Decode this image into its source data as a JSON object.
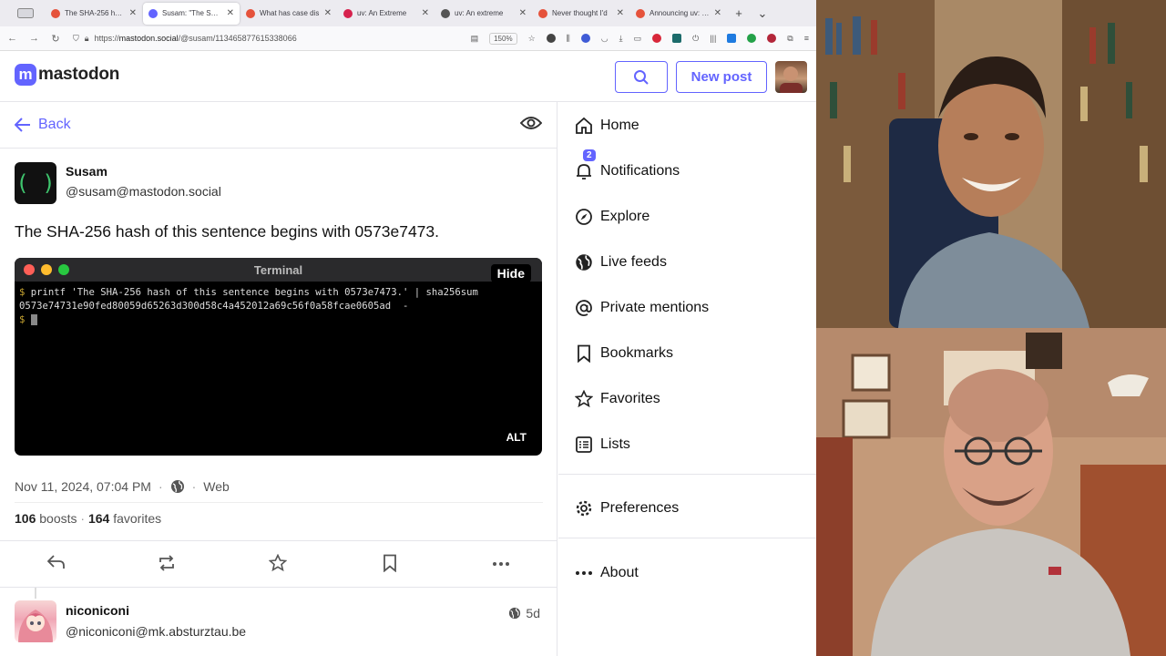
{
  "browser": {
    "tabs": [
      {
        "title": "The SHA-256 hash",
        "color": "#e5523b",
        "active": false
      },
      {
        "title": "Susam: \"The SHA-",
        "color": "#6364ff",
        "active": true
      },
      {
        "title": "What has case dis",
        "color": "#e5523b",
        "active": false
      },
      {
        "title": "uv: An Extreme",
        "color": "#d6224d",
        "active": false
      },
      {
        "title": "uv: An extreme",
        "color": "#555555",
        "active": false
      },
      {
        "title": "Never thought I'd",
        "color": "#e5523b",
        "active": false
      },
      {
        "title": "Announcing uv: Py",
        "color": "#e5523b",
        "active": false
      }
    ],
    "url_prefix": "https://",
    "url_host": "mastodon.social",
    "url_path": "/@susam/113465877615338066",
    "zoom": "150%"
  },
  "header": {
    "logo_text": "mastodon",
    "new_post": "New post"
  },
  "post": {
    "back_label": "Back",
    "author_name": "Susam",
    "author_handle": "@susam@mastodon.social",
    "text": "The SHA-256 hash of this sentence begins with 0573e7473.",
    "terminal": {
      "title": "Terminal",
      "hide_label": "Hide",
      "prompt": "$",
      "line1": " printf 'The SHA-256 hash of this sentence begins with 0573e7473.' | sha256sum",
      "line2": "0573e74731e90fed80059d65263d300d58c4a452012a69c56f0a58fcae0605ad  -",
      "alt_label": "ALT"
    },
    "date": "Nov 11, 2024, 07:04 PM",
    "dot": "·",
    "client": "Web",
    "boosts_count": "106",
    "boosts_label": "boosts",
    "favorites_count": "164",
    "favorites_label": "favorites"
  },
  "reply": {
    "name": "niconiconi",
    "handle": "@niconiconi@mk.absturztau.be",
    "time": "5d"
  },
  "nav": {
    "home": "Home",
    "notifications": "Notifications",
    "notifications_badge": "2",
    "explore": "Explore",
    "live_feeds": "Live feeds",
    "private_mentions": "Private mentions",
    "bookmarks": "Bookmarks",
    "favorites": "Favorites",
    "lists": "Lists",
    "preferences": "Preferences",
    "about": "About"
  },
  "colors": {
    "accent": "#6364ff"
  }
}
